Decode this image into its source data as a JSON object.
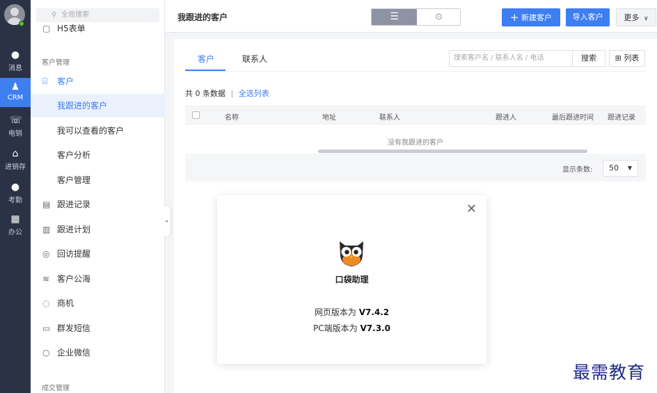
{
  "rail": {
    "items": [
      {
        "label": "消息",
        "icon": "message-icon"
      },
      {
        "label": "CRM",
        "icon": "crm-user-icon"
      },
      {
        "label": "电销",
        "icon": "phone-icon"
      },
      {
        "label": "进销存",
        "icon": "warehouse-icon"
      },
      {
        "label": "考勤",
        "icon": "location-pin-icon"
      },
      {
        "label": "办公",
        "icon": "grid-apps-icon"
      }
    ],
    "active": "CRM"
  },
  "sidebar": {
    "search_placeholder": "全局搜索",
    "top_item": "H5表单",
    "section_customer": "客户管理",
    "items": [
      {
        "label": "客户",
        "icon": "building-icon"
      },
      {
        "label": "我跟进的客户"
      },
      {
        "label": "我可以查看的客户"
      },
      {
        "label": "客户分析"
      },
      {
        "label": "客户管理"
      },
      {
        "label": "跟进记录",
        "icon": "calendar-icon"
      },
      {
        "label": "跟进计划",
        "icon": "plan-icon"
      },
      {
        "label": "回访提醒",
        "icon": "alarm-icon"
      },
      {
        "label": "客户公海",
        "icon": "waves-icon"
      },
      {
        "label": "商机",
        "icon": "opportunity-icon"
      },
      {
        "label": "群发短信",
        "icon": "sms-icon"
      },
      {
        "label": "企业微信",
        "icon": "wechat-icon"
      }
    ],
    "section_deal": "成交管理"
  },
  "topbar": {
    "title": "我跟进的客户",
    "new_customer": "新建客户",
    "import_customer": "导入客户",
    "more": "更多"
  },
  "panel": {
    "tabs": [
      "客户",
      "联系人"
    ],
    "search_placeholder": "搜索客户名 / 联系人名 / 电话",
    "search_button": "搜索",
    "list_button": "列表",
    "count_text": "共 0 条数据",
    "select_all": "全选列表",
    "columns": [
      "名称",
      "地址",
      "联系人",
      "跟进人",
      "最后跟进时间",
      "跟进记录"
    ],
    "empty_text": "没有我跟进的客户",
    "page_size_label": "显示条数:",
    "page_size": "50"
  },
  "modal": {
    "brand": "口袋助理",
    "web_prefix": "网页版本为",
    "web_version": "V7.4.2",
    "pc_prefix": "PC端版本为",
    "pc_version": "V7.3.0"
  },
  "watermark": "最需教育"
}
